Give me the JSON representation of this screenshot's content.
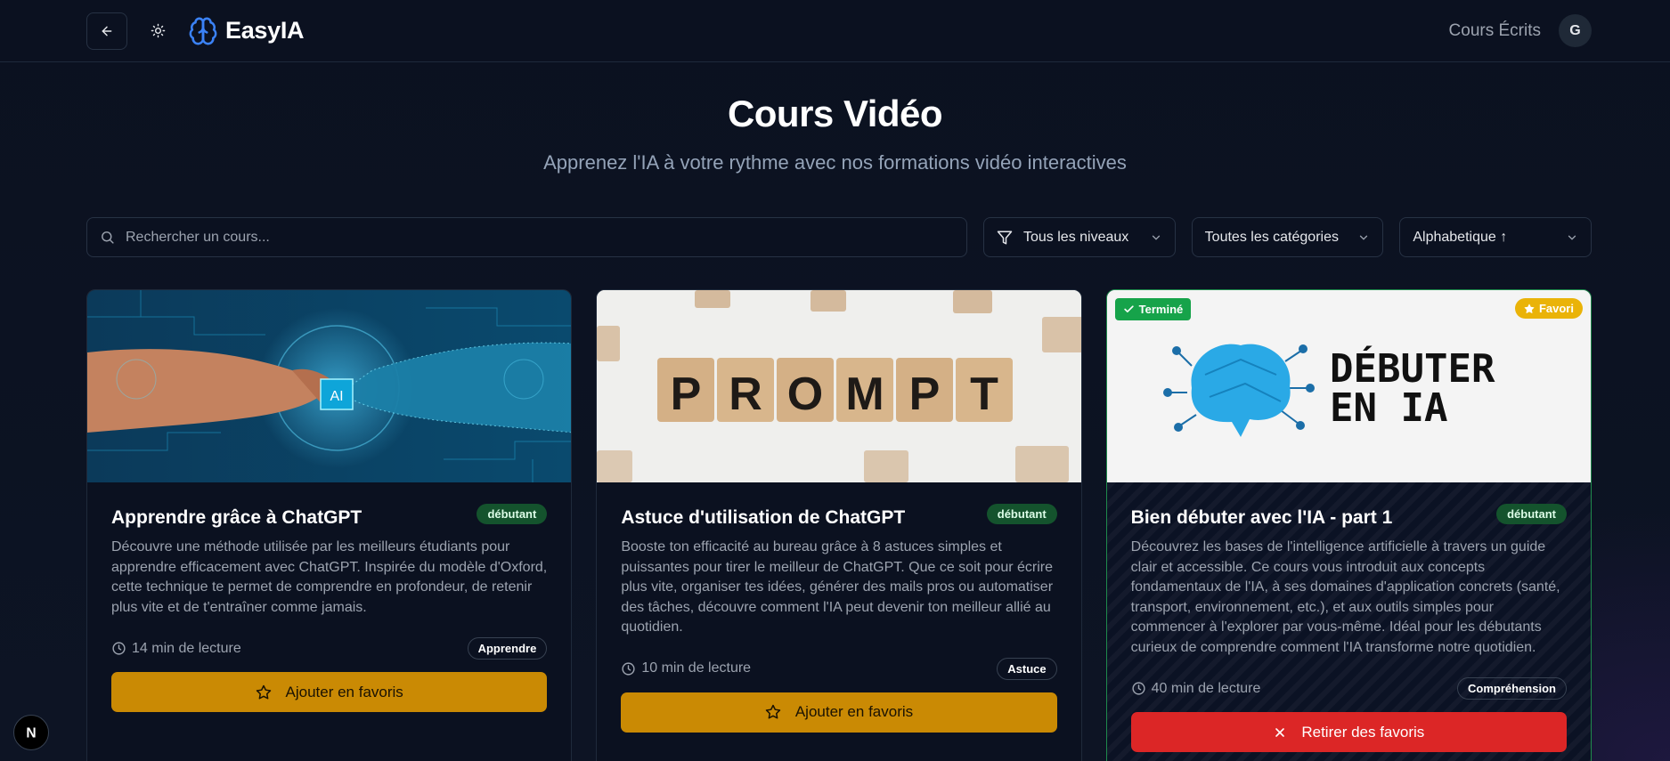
{
  "app": {
    "name": "EasyIA"
  },
  "header": {
    "nav_link": "Cours Écrits",
    "avatar_initial": "G"
  },
  "hero": {
    "title": "Cours Vidéo",
    "subtitle": "Apprenez l'IA à votre rythme avec nos formations vidéo interactives"
  },
  "filters": {
    "search_placeholder": "Rechercher un cours...",
    "level": "Tous les niveaux",
    "category": "Toutes les catégories",
    "sort": "Alphabetique ↑"
  },
  "cards": [
    {
      "title": "Apprendre grâce à ChatGPT",
      "level": "débutant",
      "description": "Découvre une méthode utilisée par les meilleurs étudiants pour apprendre efficacement avec ChatGPT. Inspirée du modèle d'Oxford, cette technique te permet de comprendre en profondeur, de retenir plus vite et de t'entraîner comme jamais.",
      "duration": "14 min de lecture",
      "tag": "Apprendre",
      "button": "Ajouter en favoris",
      "thumb_label": "AI"
    },
    {
      "title": "Astuce d'utilisation de ChatGPT",
      "level": "débutant",
      "description": "Booste ton efficacité au bureau grâce à 8 astuces simples et puissantes pour tirer le meilleur de ChatGPT. Que ce soit pour écrire plus vite, organiser tes idées, générer des mails pros ou automatiser des tâches, découvre comment l'IA peut devenir ton meilleur allié au quotidien.",
      "duration": "10 min de lecture",
      "tag": "Astuce",
      "button": "Ajouter en favoris",
      "thumb_letters": [
        "P",
        "R",
        "O",
        "M",
        "P",
        "T"
      ]
    },
    {
      "title": "Bien débuter avec l'IA - part 1",
      "level": "débutant",
      "description": "Découvrez les bases de l'intelligence artificielle à travers un guide clair et accessible. Ce cours vous introduit aux concepts fondamentaux de l'IA, à ses domaines d'application concrets (santé, transport, environnement, etc.), et aux outils simples pour commencer à l'explorer par vous-même. Idéal pour les débutants curieux de comprendre comment l'IA transforme notre quotidien.",
      "duration": "40 min de lecture",
      "tag": "Compréhension",
      "button": "Retirer des favoris",
      "status_badge": "Terminé",
      "favorite_badge": "Favori",
      "thumb_text_line1": "DÉBUTER",
      "thumb_text_line2": "EN IA"
    }
  ],
  "fab": {
    "label": "N"
  },
  "colors": {
    "background": "#0b1120",
    "accent_yellow": "#ca8a04",
    "danger_red": "#dc2626",
    "success_green": "#16a34a",
    "logo_blue": "#3b82f6"
  }
}
